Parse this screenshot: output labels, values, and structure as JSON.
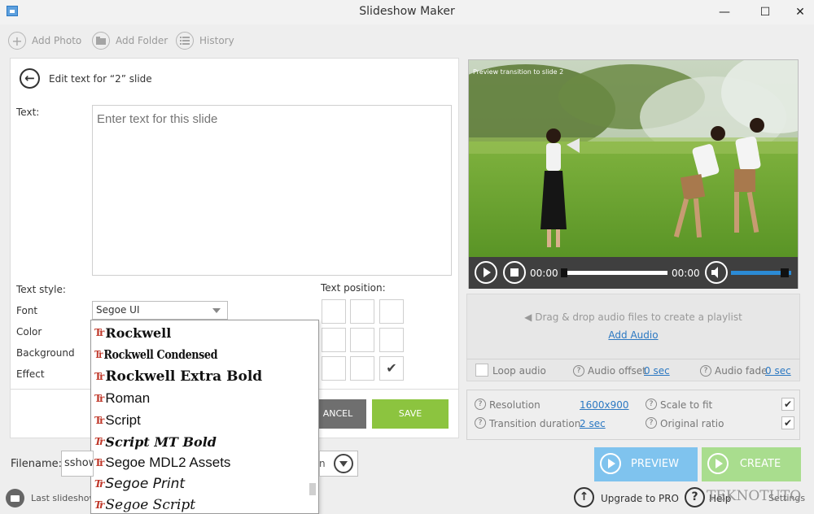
{
  "window": {
    "title": "Slideshow Maker",
    "minimize": "—",
    "maximize": "☐",
    "close": "✕"
  },
  "toolbar": {
    "add_photo": "Add Photo",
    "add_folder": "Add Folder",
    "history": "History"
  },
  "editor": {
    "title": "Edit text for “2” slide",
    "text_label": "Text:",
    "text_placeholder": "Enter text for this slide",
    "style_label": "Text style:",
    "font_label": "Font",
    "font_value": "Segoe UI",
    "color_label": "Color",
    "background_label": "Background",
    "effect_label": "Effect",
    "position_label": "Text position:",
    "position_check": "✔",
    "cancel": "ANCEL",
    "save": "SAVE"
  },
  "font_list": {
    "icon_glyph": "Tr",
    "items": [
      "Rockwell",
      "Rockwell Condensed",
      "Rockwell Extra Bold",
      "Roman",
      "Script",
      "Script MT Bold",
      "Segoe MDL2 Assets",
      "Segoe Print",
      "Segoe Script"
    ]
  },
  "filename": {
    "label": "Filename:",
    "value": "sshow",
    "format_partial": "n"
  },
  "status": {
    "last_slideshow": "Last slideshow",
    "upgrade": "Upgrade to PRO",
    "help": "Help",
    "settings": "Settings",
    "watermark": "TEKNOTUTO"
  },
  "preview": {
    "caption": "Preview transition to slide 2",
    "time_current": "00:00",
    "time_total": "00:00",
    "progress": 0.0,
    "volume": 0.85
  },
  "audio": {
    "drag_text": "Drag & drop audio files to create a playlist",
    "add_audio": "Add Audio",
    "loop_label": "Loop audio",
    "offset_label": "Audio offset",
    "offset_value": "0 sec",
    "fade_label": "Audio fade",
    "fade_value": "0 sec"
  },
  "settings": {
    "resolution_label": "Resolution",
    "resolution_value": "1600x900",
    "transition_label": "Transition duration",
    "transition_value": "2 sec",
    "scale_label": "Scale to fit",
    "ratio_label": "Original ratio",
    "check_glyph": "✔"
  },
  "actions": {
    "preview": "PREVIEW",
    "create": "CREATE"
  },
  "colors": {
    "accent_blue": "#2b78c2",
    "save_green": "#8cc43f",
    "preview_blue": "#7fc3ee",
    "create_green": "#a9dd8e"
  }
}
